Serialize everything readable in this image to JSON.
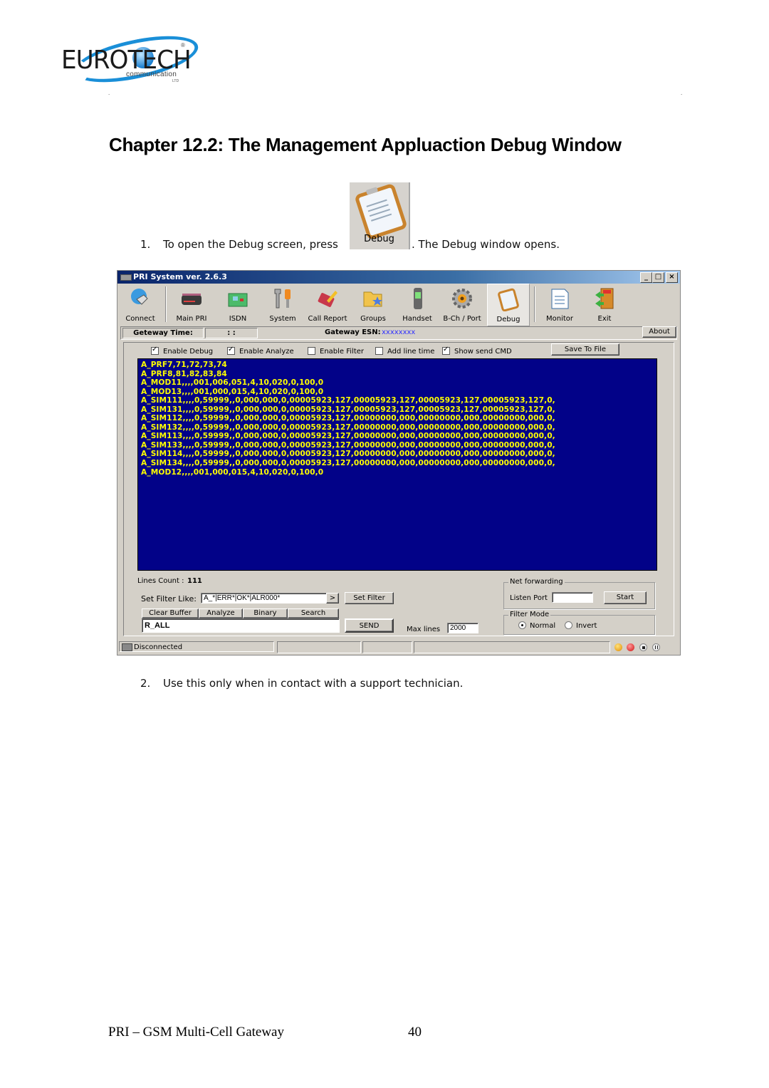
{
  "header": {
    "logo": {
      "name": "EUROTECH",
      "tagline": "communication",
      "suffix": "LTD",
      "registered": "®"
    },
    "left_mark": ".",
    "right_mark": "."
  },
  "chapter_title": "Chapter 12.2:  The Management Appluaction Debug Window",
  "steps": [
    {
      "number": "1.",
      "text_before": "To open the Debug screen, press",
      "button_label": "Debug",
      "text_after": ". The Debug window opens."
    },
    {
      "number": "2.",
      "text": "Use this only when in contact with a support technician."
    }
  ],
  "app": {
    "title": "PRI System ver. 2.6.3",
    "window_controls": [
      "_",
      "□",
      "×"
    ],
    "toolbar": [
      {
        "label": "Connect",
        "icon": "connect-plug-icon"
      },
      {
        "label": "Main PRI",
        "icon": "modem-icon"
      },
      {
        "label": "ISDN",
        "icon": "isdn-card-icon"
      },
      {
        "label": "System",
        "icon": "tools-icon"
      },
      {
        "label": "Call Report",
        "icon": "call-report-icon"
      },
      {
        "label": "Groups",
        "icon": "groups-folder-icon"
      },
      {
        "label": "Handset",
        "icon": "handset-icon"
      },
      {
        "label": "B-Ch / Port",
        "icon": "gear-icon"
      },
      {
        "label": "Debug",
        "icon": "clipboard-icon",
        "active": true
      },
      {
        "label": "Monitor",
        "icon": "monitor-document-icon"
      },
      {
        "label": "Exit",
        "icon": "exit-door-icon"
      }
    ],
    "info_bar": {
      "gateway_time_label": "Geteway Time:",
      "gateway_time_value": ":   :",
      "gateway_esn_label": "Gateway ESN:",
      "gateway_esn_value": "xxxxxxxx",
      "about_label": "About"
    },
    "options": [
      {
        "label": "Enable Debug",
        "checked": true
      },
      {
        "label": "Enable Analyze",
        "checked": true
      },
      {
        "label": "Enable Filter",
        "checked": false
      },
      {
        "label": "Add line time",
        "checked": false
      },
      {
        "label": "Show send CMD",
        "checked": true
      }
    ],
    "save_to_file_label": "Save To File",
    "log_lines": [
      "A_PRF7,71,72,73,74",
      "A_PRF8,81,82,83,84",
      "A_MOD11,,,,001,006,051,4,10,020,0,100,0",
      "A_MOD13,,,,001,000,015,4,10,020,0,100,0",
      "A_SIM111,,,,0,59999,,0,000,000,0,00005923,127,00005923,127,00005923,127,00005923,127,0,",
      "A_SIM131,,,,0,59999,,0,000,000,0,00005923,127,00005923,127,00005923,127,00005923,127,0,",
      "A_SIM112,,,,0,59999,,0,000,000,0,00005923,127,00000000,000,00000000,000,00000000,000,0,",
      "A_SIM132,,,,0,59999,,0,000,000,0,00005923,127,00000000,000,00000000,000,00000000,000,0,",
      "A_SIM113,,,,0,59999,,0,000,000,0,00005923,127,00000000,000,00000000,000,00000000,000,0,",
      "A_SIM133,,,,0,59999,,0,000,000,0,00005923,127,00000000,000,00000000,000,00000000,000,0,",
      "A_SIM114,,,,0,59999,,0,000,000,0,00005923,127,00000000,000,00000000,000,00000000,000,0,",
      "A_SIM134,,,,0,59999,,0,000,000,0,00005923,127,00000000,000,00000000,000,00000000,000,0,",
      "A_MOD12,,,,001,000,015,4,10,020,0,100,0"
    ],
    "lines_count_label": "Lines Count :",
    "lines_count_value": "111",
    "filter": {
      "label": "Set Filter Like:",
      "value": "A_*|ERR*|OK*|ALR000*",
      "arrow_label": ">",
      "set_filter_label": "Set Filter"
    },
    "buttons": {
      "clear_buffer": "Clear Buffer",
      "analyze": "Analyze",
      "binary": "Binary",
      "search": "Search",
      "send": "SEND"
    },
    "command_value": "R_ALL",
    "max_lines_label": "Max lines",
    "max_lines_value": "2000",
    "net_forwarding": {
      "title": "Net forwarding",
      "listen_port_label": "Listen Port",
      "listen_port_value": "",
      "start_label": "Start"
    },
    "filter_mode": {
      "title": "Filter Mode",
      "options": [
        {
          "label": "Normal",
          "selected": true
        },
        {
          "label": "Invert",
          "selected": false
        }
      ]
    },
    "status_text": "Disconnected",
    "colors": {
      "log_bg": "#020288",
      "log_text": "#ffff00",
      "esn_text": "#3030ff"
    }
  },
  "footer": {
    "doc_title": "PRI – GSM Multi-Cell Gateway",
    "page_number": "40"
  }
}
